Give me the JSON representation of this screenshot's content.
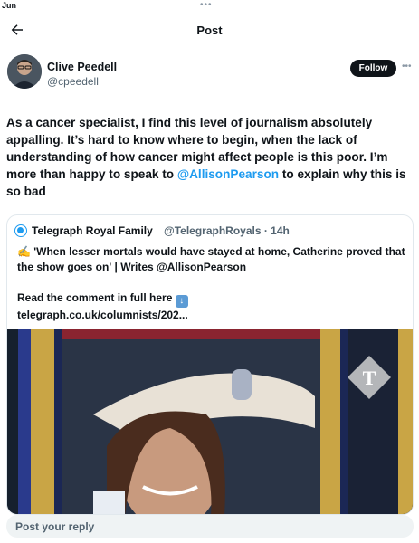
{
  "status_bar": {
    "date": "Jun",
    "dots": "•••"
  },
  "nav": {
    "title": "Post",
    "back_icon": "arrow-left-icon"
  },
  "author": {
    "name": "Clive Peedell",
    "handle": "@cpeedell",
    "follow_label": "Follow",
    "more_icon": "more-dots-icon"
  },
  "post": {
    "text_before": "As a cancer specialist, I find this level of journalism absolutely appalling. It’s hard to know where to begin, when the lack of understanding of how cancer might affect people is this poor. I’m more than happy to speak to ",
    "mention": "@AllisonPearson",
    "text_after": " to explain why this is so bad"
  },
  "quote": {
    "name": "Telegraph Royal Family",
    "handle_time": "@TelegraphRoyals · 14h",
    "line1": "✍️ 'When lesser mortals would have stayed at home, Catherine proved that the show goes on' | Writes @AllisonPearson",
    "line2_label": "Read the comment in full here",
    "line3": "telegraph.co.uk/columnists/202...",
    "image_watermark": "T"
  },
  "reply": {
    "placeholder": "Post your reply"
  },
  "colors": {
    "accent": "#1d9bf0",
    "text": "#0f1419",
    "muted": "#536471",
    "reply_bg": "#eff3f4"
  }
}
